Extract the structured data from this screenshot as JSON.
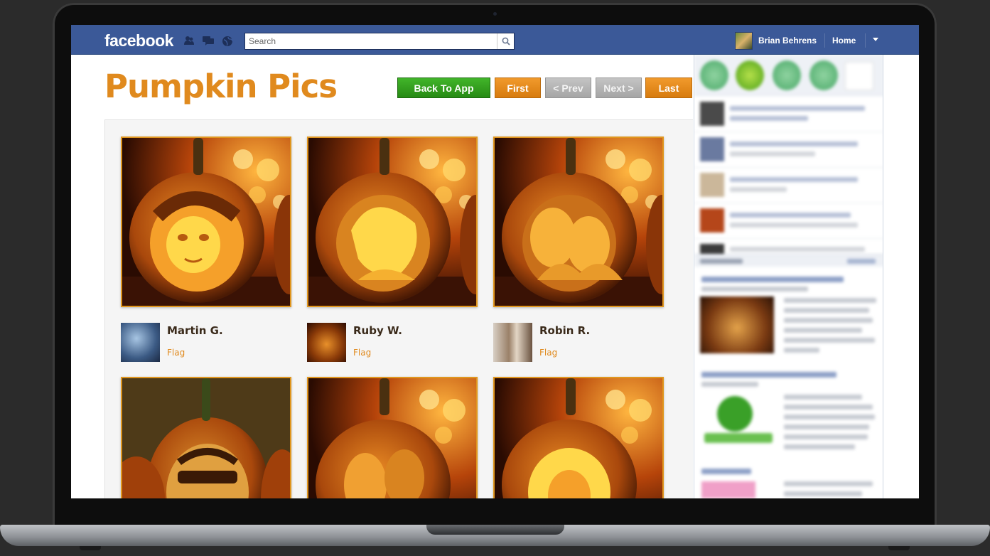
{
  "fb": {
    "logo": "facebook",
    "search_placeholder": "Search",
    "user_name": "Brian Behrens",
    "home_label": "Home"
  },
  "app": {
    "title": "Pumpkin Pics",
    "buttons": {
      "back": "Back To App",
      "first": "First",
      "prev": "< Prev",
      "next": "Next >",
      "last": "Last"
    },
    "entries": [
      {
        "name": "Martin G.",
        "flag": "Flag"
      },
      {
        "name": "Ruby W.",
        "flag": "Flag"
      },
      {
        "name": "Robin R.",
        "flag": "Flag"
      }
    ]
  },
  "colors": {
    "fb_blue": "#3b5998",
    "accent_orange": "#e08a1e",
    "back_green": "#2f9a1c",
    "disabled_grey": "#b0b0b0"
  },
  "icons": [
    "friends-icon",
    "messages-icon",
    "notifications-icon",
    "search-icon",
    "chevron-down-icon"
  ]
}
